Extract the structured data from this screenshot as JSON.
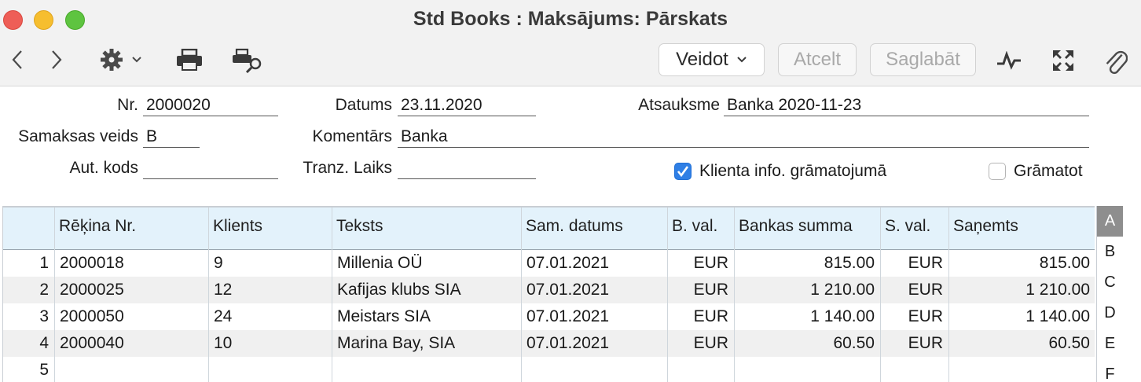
{
  "window": {
    "title": "Std Books : Maksājums: Pārskats"
  },
  "toolbar": {
    "create_label": "Veidot",
    "cancel_label": "Atcelt",
    "save_label": "Saglabāt",
    "icons": [
      "back-icon",
      "forward-icon",
      "gear-icon",
      "print-icon",
      "print-preview-icon",
      "activity-icon",
      "fullscreen-icon",
      "paperclip-icon"
    ]
  },
  "form": {
    "nr_label": "Nr.",
    "nr_value": "2000020",
    "date_label": "Datums",
    "date_value": "23.11.2020",
    "ref_label": "Atsauksme",
    "ref_value": "Banka 2020-11-23",
    "paytype_label": "Samaksas veids",
    "paytype_value": "B",
    "comment_label": "Komentārs",
    "comment_value": "Banka",
    "authcode_label": "Aut. kods",
    "authcode_value": "",
    "trantime_label": "Tranz. Laiks",
    "trantime_value": "",
    "clientinfo_label": "Klienta info. grāmatojumā",
    "clientinfo_checked": true,
    "post_label": "Grāmatot",
    "post_checked": false
  },
  "grid": {
    "columns": [
      "",
      "Rēķina Nr.",
      "Klients",
      "Teksts",
      "Sam. datums",
      "B. val.",
      "Bankas summa",
      "S. val.",
      "Saņemts"
    ],
    "rows": [
      [
        "1",
        "2000018",
        "9",
        "Millenia OÜ",
        "07.01.2021",
        "EUR",
        "815.00",
        "EUR",
        "815.00"
      ],
      [
        "2",
        "2000025",
        "12",
        "Kafijas klubs SIA",
        "07.01.2021",
        "EUR",
        "1 210.00",
        "EUR",
        "1 210.00"
      ],
      [
        "3",
        "2000050",
        "24",
        "Meistars SIA",
        "07.01.2021",
        "EUR",
        "1 140.00",
        "EUR",
        "1 140.00"
      ],
      [
        "4",
        "2000040",
        "10",
        "Marina Bay, SIA",
        "07.01.2021",
        "EUR",
        "60.50",
        "EUR",
        "60.50"
      ],
      [
        "5",
        "",
        "",
        "",
        "",
        "",
        "",
        "",
        ""
      ]
    ]
  },
  "side_tabs": [
    "A",
    "B",
    "C",
    "D",
    "E",
    "F"
  ],
  "colors": {
    "header_bg": "#e3f2fb",
    "checkbox_on": "#2f7fe5",
    "selected_tab": "#8e8e8e"
  }
}
